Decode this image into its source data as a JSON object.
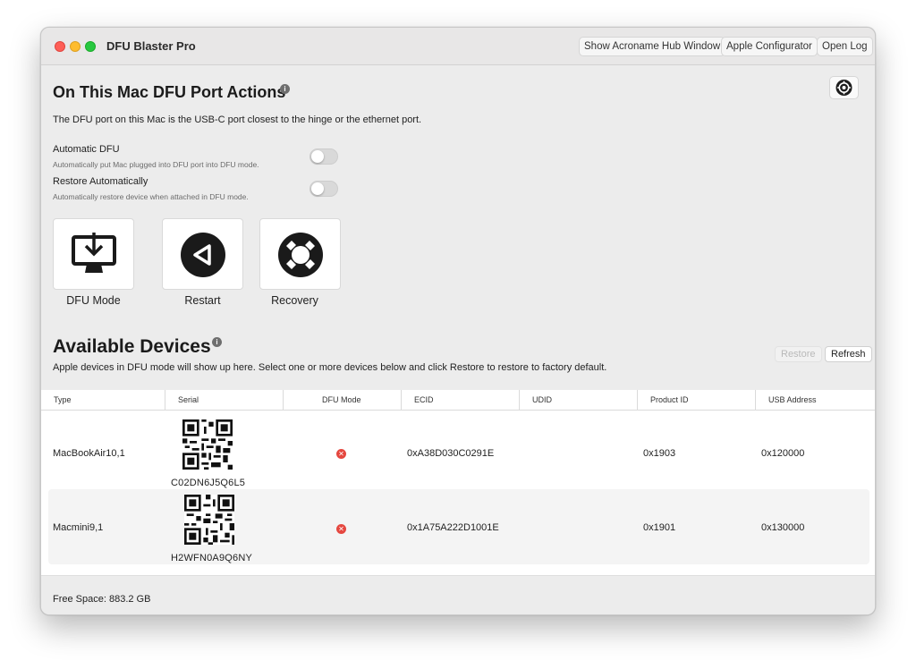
{
  "window": {
    "title": "DFU Blaster Pro",
    "toolbar": {
      "hub_label": "Show Acroname Hub Window",
      "configurator_label": "Apple Configurator",
      "open_log_label": "Open Log"
    }
  },
  "port_actions": {
    "title": "On This Mac DFU Port Actions",
    "info_icon": "info-icon",
    "description": "The DFU port on this Mac is the USB-C port closest to the hinge or the ethernet port.",
    "settings_icon": "gear-icon",
    "options": [
      {
        "label": "Automatic DFU",
        "subtitle": "Automatically put Mac plugged into DFU port into DFU mode.",
        "enabled": false
      },
      {
        "label": "Restore Automatically",
        "subtitle": "Automatically restore device when attached in DFU mode.",
        "enabled": false
      }
    ],
    "actions": [
      {
        "label": "DFU Mode",
        "icon": "imac-download-icon"
      },
      {
        "label": "Restart",
        "icon": "restart-icon"
      },
      {
        "label": "Recovery",
        "icon": "lifebuoy-icon"
      }
    ]
  },
  "devices": {
    "title": "Available Devices",
    "description": "Apple devices in DFU mode will show up here. Select one or more devices below and click Restore to restore to factory default.",
    "restore_label": "Restore",
    "refresh_label": "Refresh",
    "columns": [
      "Type",
      "Serial",
      "DFU Mode",
      "ECID",
      "UDID",
      "Product ID",
      "USB Address"
    ],
    "rows": [
      {
        "type": "MacBookAir10,1",
        "serial": "C02DN6J5Q6L5",
        "dfu_mode": "error-icon",
        "ecid": "0xA38D030C0291E",
        "udid": "",
        "product_id": "0x1903",
        "usb_address": "0x120000"
      },
      {
        "type": "Macmini9,1",
        "serial": "H2WFN0A9Q6NY",
        "dfu_mode": "error-icon",
        "ecid": "0x1A75A222D1001E",
        "udid": "",
        "product_id": "0x1901",
        "usb_address": "0x130000"
      }
    ]
  },
  "footer": {
    "free_space": "Free Space: 883.2 GB"
  },
  "colors": {
    "window_bg": "#ececec",
    "close": "#fe5f57",
    "minimize": "#febc2e",
    "maximize": "#28c840",
    "error": "#e5473f"
  }
}
